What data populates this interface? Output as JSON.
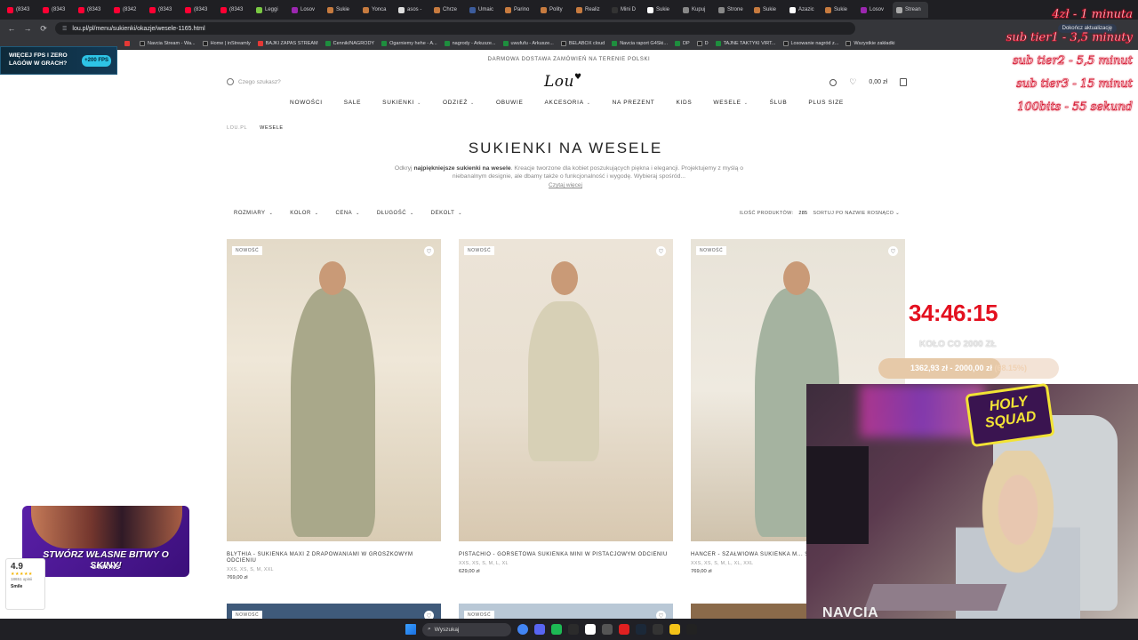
{
  "browser": {
    "tabs": [
      {
        "label": "(8343",
        "color": "#ff0033"
      },
      {
        "label": "(8343",
        "color": "#ff0033"
      },
      {
        "label": "(8343",
        "color": "#ff0033"
      },
      {
        "label": "(8342",
        "color": "#ff0033"
      },
      {
        "label": "(8343",
        "color": "#ff0033"
      },
      {
        "label": "(8343",
        "color": "#ff0033"
      },
      {
        "label": "(8343",
        "color": "#ff0033"
      },
      {
        "label": "Leggi",
        "color": "#7ac943"
      },
      {
        "label": "Losov",
        "color": "#9c27b0"
      },
      {
        "label": "Sukie",
        "color": "#c77b3f"
      },
      {
        "label": "Yonca",
        "color": "#c77b3f"
      },
      {
        "label": "asos -",
        "color": "#e0e0e0"
      },
      {
        "label": "Chrze",
        "color": "#c77b3f"
      },
      {
        "label": "Umaic",
        "color": "#3c5c9c"
      },
      {
        "label": "Parino",
        "color": "#c77b3f"
      },
      {
        "label": "Polity",
        "color": "#c77b3f"
      },
      {
        "label": "Realiz",
        "color": "#c77b3f"
      },
      {
        "label": "Mini D",
        "color": "#333333"
      },
      {
        "label": "Sukie",
        "color": "#ffffff"
      },
      {
        "label": "Kupuj",
        "color": "#888888"
      },
      {
        "label": "Strone",
        "color": "#888888"
      },
      {
        "label": "Sukie",
        "color": "#c77b3f"
      },
      {
        "label": "Azazic",
        "color": "#ffffff"
      },
      {
        "label": "Sukie",
        "color": "#c77b3f"
      },
      {
        "label": "Losov",
        "color": "#9c27b0"
      },
      {
        "label": "Strean",
        "color": "#aaaaaa"
      }
    ],
    "url": "lou.pl/pl/menu/sukienki/okazje/wesele-1165.html",
    "update_label": "Dokończ aktualizację",
    "bookmarks": [
      {
        "label": "",
        "type": "r"
      },
      {
        "label": "Navcia Stream - Wa...",
        "type": "d"
      },
      {
        "label": "Home | inStreamly",
        "type": "d"
      },
      {
        "label": "BAJKI ZAPAS STREAM",
        "type": "r"
      },
      {
        "label": "Cennik/NAGRODY",
        "type": "g"
      },
      {
        "label": "Ogarniemy hehe - A...",
        "type": "g"
      },
      {
        "label": "nagrody - Arkusze...",
        "type": "g"
      },
      {
        "label": "uwufufu - Arkusze...",
        "type": "g"
      },
      {
        "label": "BELABOX cloud",
        "type": "d"
      },
      {
        "label": "Navcia raport G4Ski...",
        "type": "g"
      },
      {
        "label": "DP",
        "type": "g"
      },
      {
        "label": "D",
        "type": "d"
      },
      {
        "label": "TAJNE TAKTYKI VIRT...",
        "type": "g"
      },
      {
        "label": "Losowanie nagród z...",
        "type": "d"
      },
      {
        "label": "Wszystkie zakładki",
        "type": "d"
      }
    ]
  },
  "site": {
    "promo": "DARMOWA DOSTAWA ZAMÓWIEŃ NA TERENIE POLSKI",
    "search_placeholder": "Czego szukasz?",
    "logo": "Lou",
    "cart_total": "0,00 zł",
    "menu": [
      {
        "label": "NOWOŚCI",
        "dropdown": false
      },
      {
        "label": "SALE",
        "dropdown": false
      },
      {
        "label": "SUKIENKI",
        "dropdown": true
      },
      {
        "label": "ODZIEŻ",
        "dropdown": true
      },
      {
        "label": "OBUWIE",
        "dropdown": false
      },
      {
        "label": "AKCESORIA",
        "dropdown": true
      },
      {
        "label": "NA PREZENT",
        "dropdown": false
      },
      {
        "label": "KIDS",
        "dropdown": false
      },
      {
        "label": "WESELE",
        "dropdown": true
      },
      {
        "label": "ŚLUB",
        "dropdown": false
      },
      {
        "label": "PLUS SIZE",
        "dropdown": false
      }
    ],
    "breadcrumb": [
      "LOU.PL",
      "WESELE"
    ],
    "title": "SUKIENKI NA WESELE",
    "desc_pre": "Odkryj ",
    "desc_bold": "najpiękniejsze sukienki na wesele",
    "desc_post": ". Kreacje tworzone dla kobiet poszukujących piękna i elegancji. Projektujemy z myślą o niebanalnym designie, ale dbamy także o funkcjonalność i wygodę. Wybieraj spośród...",
    "read_more": "Czytaj więcej",
    "filters": [
      "ROZMIARY",
      "KOLOR",
      "CENA",
      "DŁUGOŚĆ",
      "DEKOLT"
    ],
    "count_label": "ILOŚĆ PRODUKTÓW:",
    "count_value": "285",
    "sort_label": "SORTUJ PO NAZWIE ROSNĄCO",
    "products": [
      {
        "badge": "NOWOŚĆ",
        "name": "BLYTHIA - SUKIENKA MAXI Z DRAPOWANIAMI W GROSZKOWYM ODCIENIU",
        "sizes": "XXS, XS, S, M, XXL",
        "price": "769,00 zł",
        "dress": "#a9a88a"
      },
      {
        "badge": "NOWOŚĆ",
        "name": "PISTACHIO - GORSETOWA SUKIENKA MINI W PISTACJOWYM ODCIENIU",
        "sizes": "XXS, XS, S, M, L, XL",
        "price": "629,00 zł",
        "dress": "#d7d0b6"
      },
      {
        "badge": "NOWOŚĆ",
        "name": "HANCER - SZAŁWIOWA SUKIENKA M... SPLOTEM",
        "sizes": "XXS, XS, S, M, L, XL, XXL",
        "price": "769,00 zł",
        "dress": "#a5b3a0"
      }
    ],
    "row2_badge": "NOWOŚĆ"
  },
  "overlays": {
    "ad_top": {
      "line1": "WIĘCEJ FPS I ZERO",
      "line2": "LAGÓW W GRACH?",
      "badge": "+200 FPS"
    },
    "sub_info": [
      "4zł - 1 minuta",
      "sub tier1 - 3,5 minuty",
      "sub tier2 - 5,5 minut",
      "sub tier3 - 15 minut",
      "100bits - 55 sekund"
    ],
    "timer": "34:46:15",
    "goal_label": "KOŁO CO 2000 ZŁ",
    "goal_text": "1362,93 zł - 2000,00 zł",
    "goal_pct_text": "(68.15%)",
    "goal_pct": 68.15,
    "holy_squad": "HOLY SQUAD",
    "navcia": "NAVCIA",
    "ad_bottom": {
      "line1": "STWÓRZ WŁASNE BITWY O SKINY!",
      "line2": "G4SKINS"
    },
    "rating": {
      "value": "4.9",
      "stars": "★★★★★",
      "count": "18651 opinii",
      "brand": "Smile"
    }
  },
  "taskbar": {
    "search": "Wyszukaj",
    "apps": [
      {
        "color": "#4285f4"
      },
      {
        "color": "#5865f2"
      },
      {
        "color": "#1db954"
      },
      {
        "color": "#2b2b2b"
      },
      {
        "color": "#ffffff"
      },
      {
        "color": "#555555"
      },
      {
        "color": "#e02020"
      },
      {
        "color": "#1b2838"
      },
      {
        "color": "#333333"
      },
      {
        "color": "#f3c318"
      },
      {
        "color": "#222222"
      }
    ]
  }
}
